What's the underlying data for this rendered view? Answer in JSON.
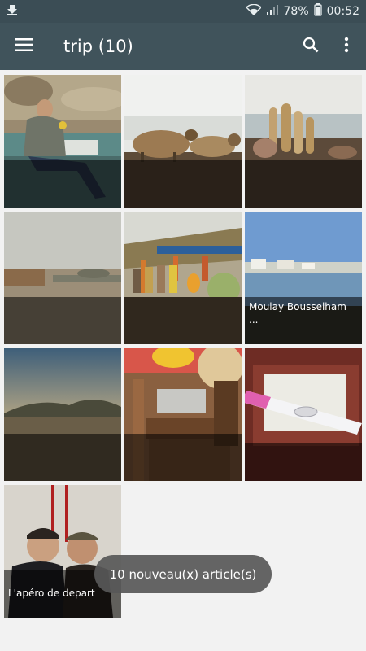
{
  "status_bar": {
    "battery": "78%",
    "time": "00:52"
  },
  "app_bar": {
    "title": "trip (10)"
  },
  "photos": [
    {
      "caption": ""
    },
    {
      "caption": ""
    },
    {
      "caption": ""
    },
    {
      "caption": ""
    },
    {
      "caption": ""
    },
    {
      "caption": "Moulay Bousselham ..."
    },
    {
      "caption": ""
    },
    {
      "caption": ""
    },
    {
      "caption": ""
    },
    {
      "caption": "L'apéro de depart"
    }
  ],
  "toast": {
    "message": "10 nouveau(x) article(s)"
  },
  "icons": {
    "download": "download-icon",
    "wifi": "wifi-icon",
    "signal": "signal-icon",
    "battery": "battery-icon",
    "menu": "menu-icon",
    "search": "search-icon",
    "more": "more-vert-icon"
  },
  "colors": {
    "status_bar": "#3b4d55",
    "app_bar": "#40535b",
    "background": "#f2f2f2"
  }
}
